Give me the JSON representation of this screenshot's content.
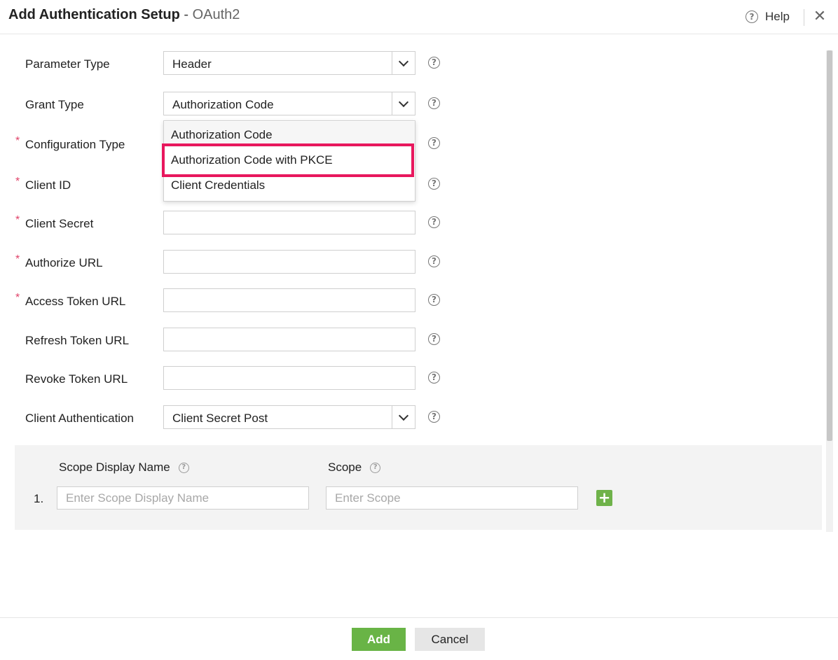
{
  "header": {
    "title": "Add Authentication Setup",
    "separator": " - ",
    "subtitle": "OAuth2",
    "help_icon": "?",
    "help_label": "Help",
    "close_icon": "✕"
  },
  "form": {
    "parameter_type": {
      "label": "Parameter Type",
      "value": "Header"
    },
    "grant_type": {
      "label": "Grant Type",
      "value": "Authorization Code",
      "options": [
        "Authorization Code",
        "Authorization Code with PKCE",
        "Client Credentials"
      ]
    },
    "configuration_type": {
      "label": "Configuration Type",
      "required_mark": "*"
    },
    "client_id": {
      "label": "Client ID",
      "required_mark": "*"
    },
    "client_secret": {
      "label": "Client Secret",
      "required_mark": "*",
      "value": ""
    },
    "authorize_url": {
      "label": "Authorize URL",
      "required_mark": "*",
      "value": ""
    },
    "access_token_url": {
      "label": "Access Token URL",
      "required_mark": "*",
      "value": ""
    },
    "refresh_token_url": {
      "label": "Refresh Token URL",
      "value": ""
    },
    "revoke_token_url": {
      "label": "Revoke Token URL",
      "value": ""
    },
    "client_authentication": {
      "label": "Client Authentication",
      "value": "Client Secret Post"
    },
    "help_icon": "?"
  },
  "scope": {
    "display_name_header": "Scope Display Name",
    "scope_header": "Scope",
    "help_icon": "?",
    "rows": [
      {
        "number": "1.",
        "display_name_placeholder": "Enter Scope Display Name",
        "scope_placeholder": "Enter Scope"
      }
    ],
    "add_icon": "+"
  },
  "footer": {
    "add_label": "Add",
    "cancel_label": "Cancel"
  },
  "colors": {
    "accent_green": "#69b446",
    "highlight_border": "#e8175d",
    "required_mark": "#e0446a"
  }
}
